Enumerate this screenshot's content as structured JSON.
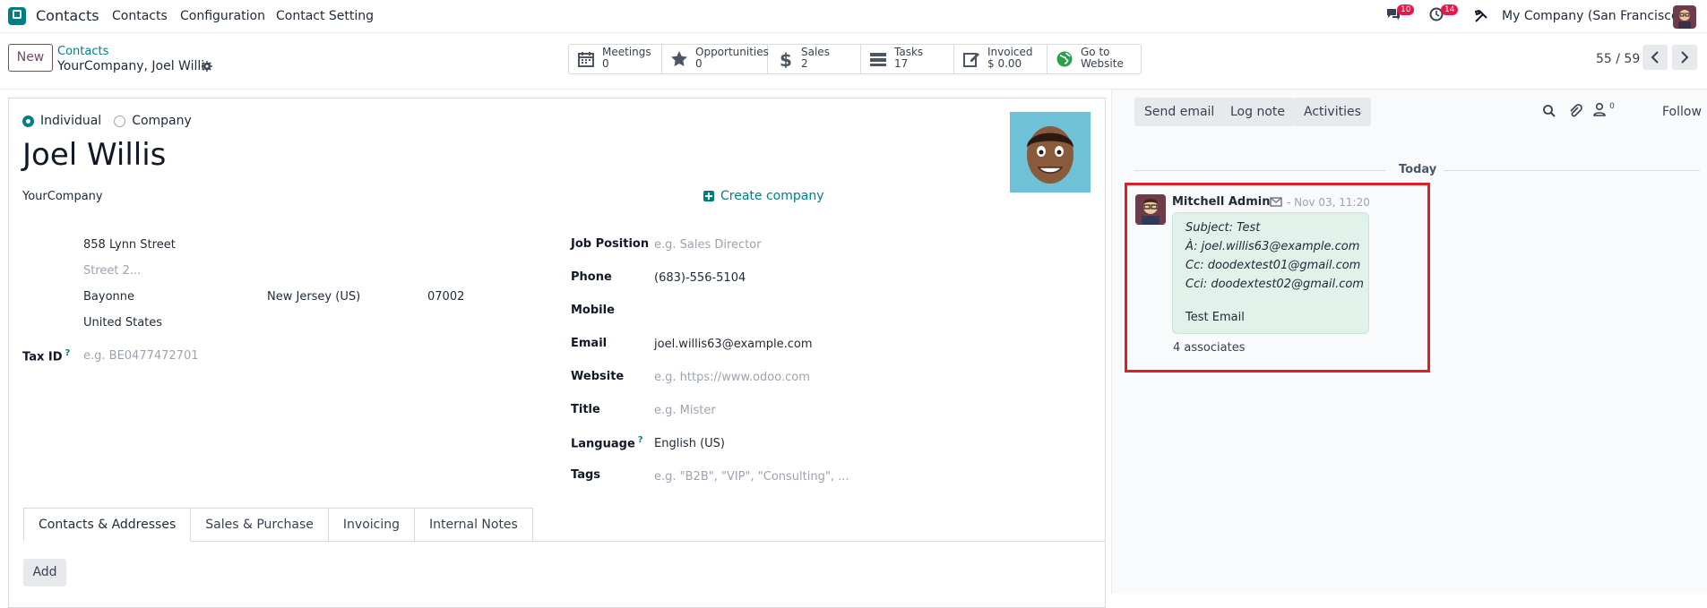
{
  "navbar": {
    "app_name": "Contacts",
    "menus": [
      "Contacts",
      "Configuration",
      "Contact Setting"
    ],
    "messages_count": "10",
    "activities_count": "14",
    "company": "My Company (San Francisco)"
  },
  "control": {
    "new_label": "New",
    "breadcrumb_parent": "Contacts",
    "breadcrumb_current": "YourCompany, Joel Willis",
    "smart_buttons": [
      {
        "label": "Meetings",
        "value": "0",
        "icon": "calendar-icon"
      },
      {
        "label": "Opportunities",
        "value": "0",
        "icon": "star-icon"
      },
      {
        "label": "Sales",
        "value": "2",
        "icon": "dollar-icon"
      },
      {
        "label": "Tasks",
        "value": "17",
        "icon": "tasks-icon"
      },
      {
        "label": "Invoiced",
        "value": "$ 0.00",
        "icon": "edit-icon"
      },
      {
        "label": "Go to",
        "value": "Website",
        "icon": "globe-icon"
      }
    ],
    "pager": "55 / 59"
  },
  "form": {
    "type_individual": "Individual",
    "type_company": "Company",
    "name": "Joel Willis",
    "company": "YourCompany",
    "create_company": "Create company",
    "street": "858 Lynn Street",
    "street2_placeholder": "Street 2...",
    "city": "Bayonne",
    "state": "New Jersey (US)",
    "zip": "07002",
    "country": "United States",
    "tax_id_label": "Tax ID",
    "tax_id_placeholder": "e.g. BE0477472701",
    "job_position_label": "Job Position",
    "job_position_placeholder": "e.g. Sales Director",
    "phone_label": "Phone",
    "phone": "(683)-556-5104",
    "mobile_label": "Mobile",
    "email_label": "Email",
    "email": "joel.willis63@example.com",
    "website_label": "Website",
    "website_placeholder": "e.g. https://www.odoo.com",
    "title_label": "Title",
    "title_placeholder": "e.g. Mister",
    "language_label": "Language",
    "language": "English (US)",
    "tags_label": "Tags",
    "tags_placeholder": "e.g. \"B2B\", \"VIP\", \"Consulting\", ...",
    "help_mark": "?"
  },
  "tabs": [
    "Contacts & Addresses",
    "Sales & Purchase",
    "Invoicing",
    "Internal Notes"
  ],
  "add_label": "Add",
  "chatter": {
    "send_email": "Send email",
    "log_note": "Log note",
    "activities": "Activities",
    "followers_count": "0",
    "follow": "Follow",
    "today": "Today",
    "message": {
      "author": "Mitchell Admin",
      "time": "- Nov 03, 11:20",
      "subject": "Subject: Test",
      "to": "À: joel.willis63@example.com",
      "cc": "Cc: doodextest01@gmail.com",
      "bcc": "Cci: doodextest02@gmail.com",
      "body": "Test Email",
      "associates": "4 associates"
    }
  },
  "colors": {
    "brand": "#714b67",
    "accent": "#017e84",
    "highlight": "#e01e26"
  }
}
